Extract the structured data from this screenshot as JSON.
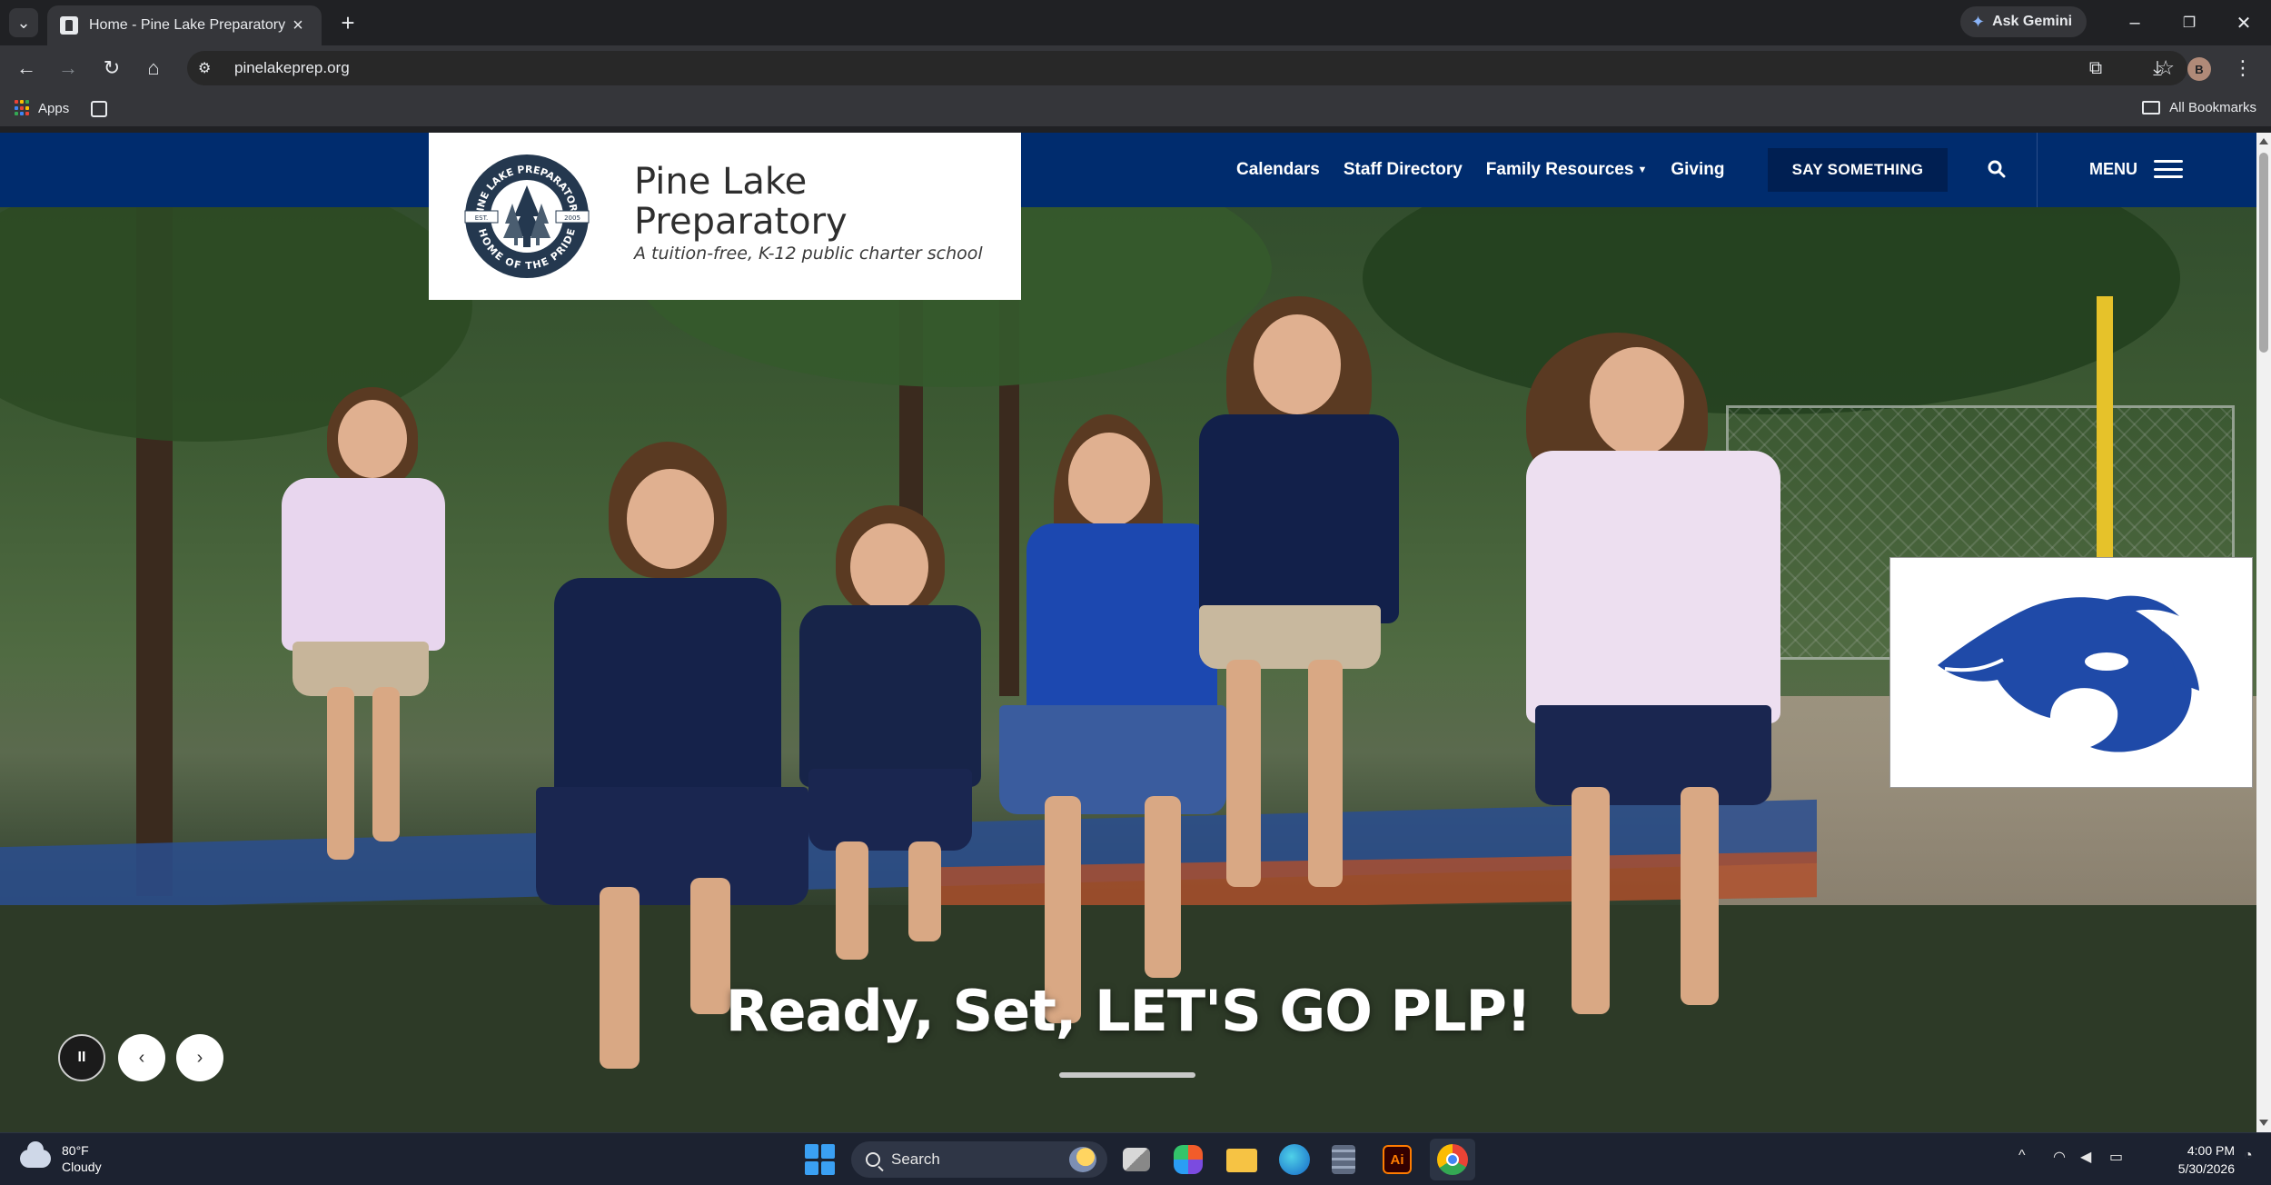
{
  "browser": {
    "tab_title": "Home - Pine Lake Preparatory",
    "url": "pinelakeprep.org",
    "ask_gemini": "Ask Gemini",
    "avatar_letter": "B",
    "bookmarks": {
      "apps": "Apps",
      "all_bookmarks": "All Bookmarks"
    }
  },
  "site": {
    "school_name_line1": "Pine Lake",
    "school_name_line2": "Preparatory",
    "tagline": "A tuition-free, K-12 public charter school",
    "seal": {
      "top_text": "PINE LAKE PREPARATORY",
      "bottom_text": "HOME OF THE PRIDE",
      "est": "EST.",
      "year": "2005"
    },
    "nav": {
      "calendars": "Calendars",
      "staff_directory": "Staff Directory",
      "family_resources": "Family Resources",
      "giving": "Giving",
      "say_something": "SAY SOMETHING",
      "menu": "MENU"
    },
    "hero": {
      "caption": "Ready, Set, LET'S GO PLP!"
    },
    "colors": {
      "navy": "#002c6e",
      "mascot_blue": "#1f4aa8"
    }
  },
  "taskbar": {
    "weather_temp": "80°F",
    "weather_cond": "Cloudy",
    "search_label": "Search",
    "time": "4:00 PM",
    "date": "5/30/2026"
  }
}
